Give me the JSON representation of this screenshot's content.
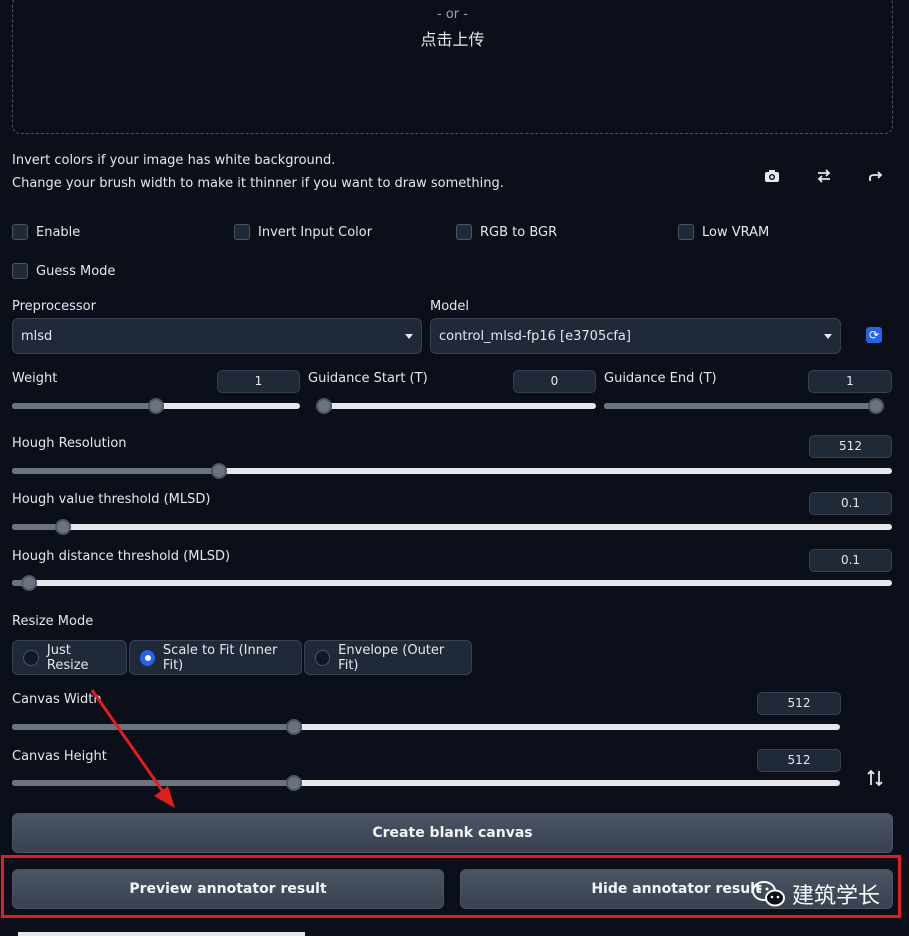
{
  "upload": {
    "or_text": "- or -",
    "click_text": "点击上传"
  },
  "hints": {
    "line1": "Invert colors if your image has white background.",
    "line2": "Change your brush width to make it thinner if you want to draw something."
  },
  "tool_icons": [
    "camera-icon",
    "swap-icon",
    "rotate-arrow-icon"
  ],
  "checkboxes": {
    "enable": "Enable",
    "invert": "Invert Input Color",
    "rgb": "RGB to BGR",
    "lowvram": "Low VRAM",
    "guess": "Guess Mode"
  },
  "preprocessor": {
    "label": "Preprocessor",
    "value": "mlsd"
  },
  "model": {
    "label": "Model",
    "value": "control_mlsd-fp16 [e3705cfa]"
  },
  "weight": {
    "label": "Weight",
    "value": "1",
    "fraction": 0.5
  },
  "guidance_start": {
    "label": "Guidance Start (T)",
    "value": "0",
    "fraction": 0.0
  },
  "guidance_end": {
    "label": "Guidance End (T)",
    "value": "1",
    "fraction": 1.0
  },
  "hough_resolution": {
    "label": "Hough Resolution",
    "value": "512",
    "fraction": 0.23
  },
  "hough_value": {
    "label": "Hough value threshold (MLSD)",
    "value": "0.1",
    "fraction": 0.05
  },
  "hough_distance": {
    "label": "Hough distance threshold (MLSD)",
    "value": "0.1",
    "fraction": 0.01
  },
  "resize_mode": {
    "label": "Resize Mode",
    "options": [
      "Just Resize",
      "Scale to Fit (Inner Fit)",
      "Envelope (Outer Fit)"
    ],
    "selected": "Scale to Fit (Inner Fit)"
  },
  "canvas_width": {
    "label": "Canvas Width",
    "value": "512",
    "fraction": 0.337
  },
  "canvas_height": {
    "label": "Canvas Height",
    "value": "512",
    "fraction": 0.337
  },
  "buttons": {
    "create": "Create blank canvas",
    "preview": "Preview annotator result",
    "hide": "Hide annotator result"
  },
  "watermark": {
    "text": "建筑学长"
  },
  "colors": {
    "accent": "#2563eb",
    "highlight": "#e11d1d",
    "background": "#0b0f19"
  }
}
